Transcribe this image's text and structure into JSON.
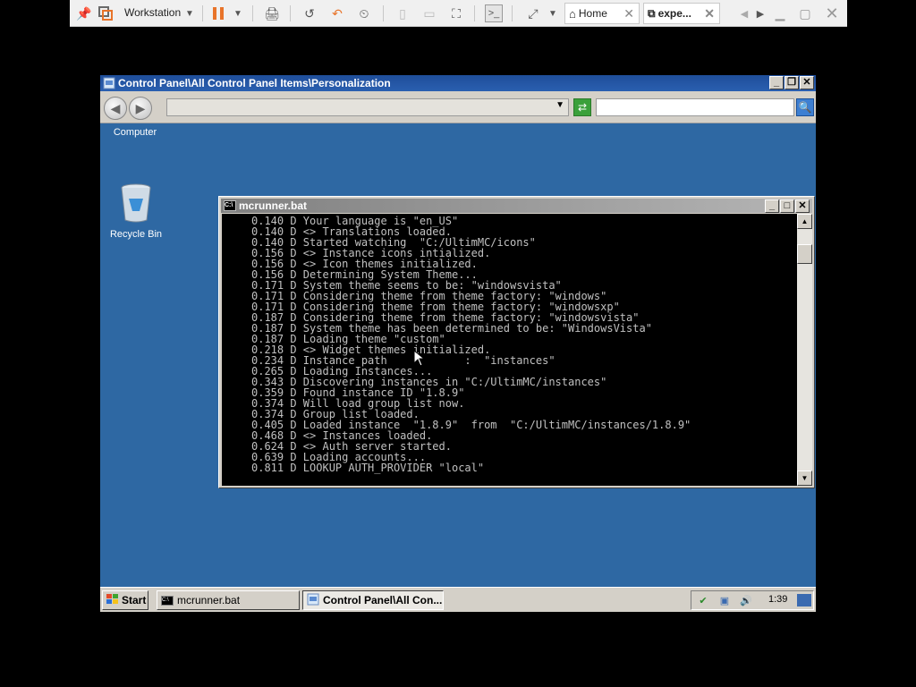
{
  "vmware": {
    "product_label": "Workstation",
    "tabs": [
      {
        "label": "Home"
      },
      {
        "label": "expe..."
      }
    ]
  },
  "explorer": {
    "title": "Control Panel\\All Control Panel Items\\Personalization",
    "address_value": "",
    "search_value": "",
    "breadcrumb_label": "Computer"
  },
  "desktop": {
    "recycle_bin_label": "Recycle Bin"
  },
  "console": {
    "title": "mcrunner.bat",
    "lines": [
      "0.140 D Your language is \"en_US\"",
      "0.140 D <> Translations loaded.",
      "0.140 D Started watching  \"C:/UltimMC/icons\"",
      "0.156 D <> Instance icons intialized.",
      "0.156 D <> Icon themes initialized.",
      "0.156 D Determining System Theme...",
      "0.171 D System theme seems to be: \"windowsvista\"",
      "0.171 D Considering theme from theme factory: \"windows\"",
      "0.171 D Considering theme from theme factory: \"windowsxp\"",
      "0.187 D Considering theme from theme factory: \"windowsvista\"",
      "0.187 D System theme has been determined to be: \"WindowsVista\"",
      "0.187 D Loading theme \"custom\"",
      "0.218 D <> Widget themes initialized.",
      "0.234 D Instance path            :  \"instances\"",
      "0.265 D Loading Instances...",
      "0.343 D Discovering instances in \"C:/UltimMC/instances\"",
      "0.359 D Found instance ID \"1.8.9\"",
      "0.374 D Will load group list now.",
      "0.374 D Group list loaded.",
      "0.405 D Loaded instance  \"1.8.9\"  from  \"C:/UltimMC/instances/1.8.9\"",
      "0.468 D <> Instances loaded.",
      "0.624 D <> Auth server started.",
      "0.639 D Loading accounts...",
      "0.811 D LOOKUP AUTH_PROVIDER \"local\""
    ]
  },
  "taskbar": {
    "start_label": "Start",
    "tasks": [
      {
        "label": "mcrunner.bat"
      },
      {
        "label": "Control Panel\\All Con..."
      }
    ],
    "clock": "1:39"
  },
  "colors": {
    "desktop": "#2e68a3",
    "explorer_title": "#1f4e9a",
    "console_text": "#c0c0c0",
    "vm_pause": "#e8742a"
  }
}
